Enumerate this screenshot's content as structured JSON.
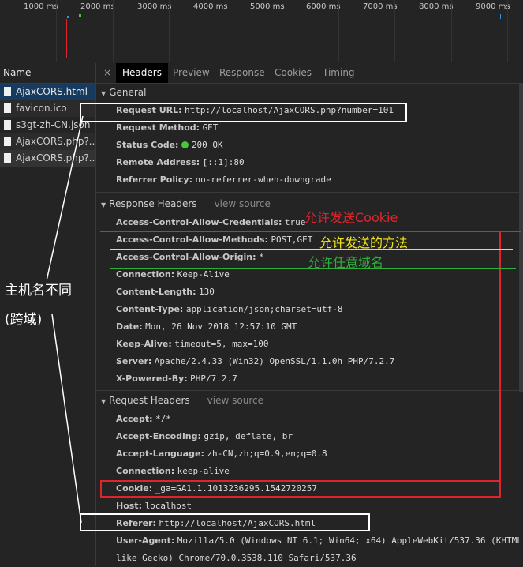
{
  "timeline": {
    "ticks": [
      "1000 ms",
      "2000 ms",
      "3000 ms",
      "4000 ms",
      "5000 ms",
      "6000 ms",
      "7000 ms",
      "8000 ms",
      "9000 ms"
    ]
  },
  "requests": {
    "header": "Name",
    "items": [
      {
        "name": "AjaxCORS.html",
        "selected": true
      },
      {
        "name": "favicon.ico"
      },
      {
        "name": "s3gt-zh-CN.json"
      },
      {
        "name": "AjaxCORS.php?..."
      },
      {
        "name": "AjaxCORS.php?..."
      }
    ]
  },
  "tabs": {
    "close": "×",
    "items": [
      "Headers",
      "Preview",
      "Response",
      "Cookies",
      "Timing"
    ],
    "active": "Headers"
  },
  "general": {
    "title": "General",
    "rows": [
      {
        "k": "Request URL:",
        "v": "http://localhost/AjaxCORS.php?number=101"
      },
      {
        "k": "Request Method:",
        "v": "GET"
      },
      {
        "k": "Status Code:",
        "v": "200 OK"
      },
      {
        "k": "Remote Address:",
        "v": "[::1]:80"
      },
      {
        "k": "Referrer Policy:",
        "v": "no-referrer-when-downgrade"
      }
    ]
  },
  "response_headers": {
    "title": "Response Headers",
    "view_source": "view source",
    "rows": [
      {
        "k": "Access-Control-Allow-Credentials:",
        "v": "true"
      },
      {
        "k": "Access-Control-Allow-Methods:",
        "v": "POST,GET"
      },
      {
        "k": "Access-Control-Allow-Origin:",
        "v": "*"
      },
      {
        "k": "Connection:",
        "v": "Keep-Alive"
      },
      {
        "k": "Content-Length:",
        "v": "130"
      },
      {
        "k": "Content-Type:",
        "v": "application/json;charset=utf-8"
      },
      {
        "k": "Date:",
        "v": "Mon, 26 Nov 2018 12:57:10 GMT"
      },
      {
        "k": "Keep-Alive:",
        "v": "timeout=5, max=100"
      },
      {
        "k": "Server:",
        "v": "Apache/2.4.33 (Win32) OpenSSL/1.1.0h PHP/7.2.7"
      },
      {
        "k": "X-Powered-By:",
        "v": "PHP/7.2.7"
      }
    ]
  },
  "request_headers": {
    "title": "Request Headers",
    "view_source": "view source",
    "rows": [
      {
        "k": "Accept:",
        "v": "*/*"
      },
      {
        "k": "Accept-Encoding:",
        "v": "gzip, deflate, br"
      },
      {
        "k": "Accept-Language:",
        "v": "zh-CN,zh;q=0.9,en;q=0.8"
      },
      {
        "k": "Connection:",
        "v": "keep-alive"
      },
      {
        "k": "Cookie:",
        "v": "_ga=GA1.1.1013236295.1542720257"
      },
      {
        "k": "Host:",
        "v": "localhost"
      },
      {
        "k": "Referer:",
        "v": "http://localhost/AjaxCORS.html"
      },
      {
        "k": "User-Agent:",
        "v": "Mozilla/5.0 (Windows NT 6.1; Win64; x64) AppleWebKit/537.36 (KHTML,"
      },
      {
        "k": "",
        "v": "like Gecko) Chrome/70.0.3538.110 Safari/537.36"
      }
    ]
  },
  "annotations": {
    "credentials": "允许发送Cookie",
    "methods": "允许发送的方法",
    "origin": "允许任意域名",
    "host_line1": "主机名不同",
    "host_line2": "(跨域)"
  },
  "colors": {
    "red": "#e0242c",
    "yellow": "#f2e619",
    "green": "#2fae3a",
    "white": "#ffffff",
    "status_dot": "#43c93a",
    "selected": "#163b5f"
  }
}
